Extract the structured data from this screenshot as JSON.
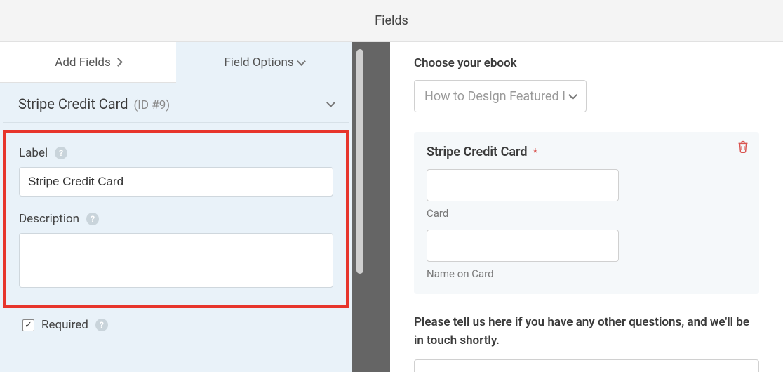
{
  "topbar": {
    "title": "Fields"
  },
  "tabs": {
    "add": "Add Fields",
    "options": "Field Options"
  },
  "field_header": {
    "title": "Stripe Credit Card",
    "id": "(ID #9)"
  },
  "options": {
    "label_text": "Label",
    "label_value": "Stripe Credit Card",
    "description_text": "Description",
    "description_value": "",
    "required_text": "Required",
    "required_checked": "✓"
  },
  "preview": {
    "ebook_label": "Choose your ebook",
    "ebook_selected": "How to Design Featured I",
    "cc_title": "Stripe Credit Card",
    "cc_card_sub": "Card",
    "cc_name_sub": "Name on Card",
    "question_label": "Please tell us here if you have any other questions, and we'll be in touch shortly."
  },
  "icons": {
    "help": "?",
    "star": "*"
  }
}
